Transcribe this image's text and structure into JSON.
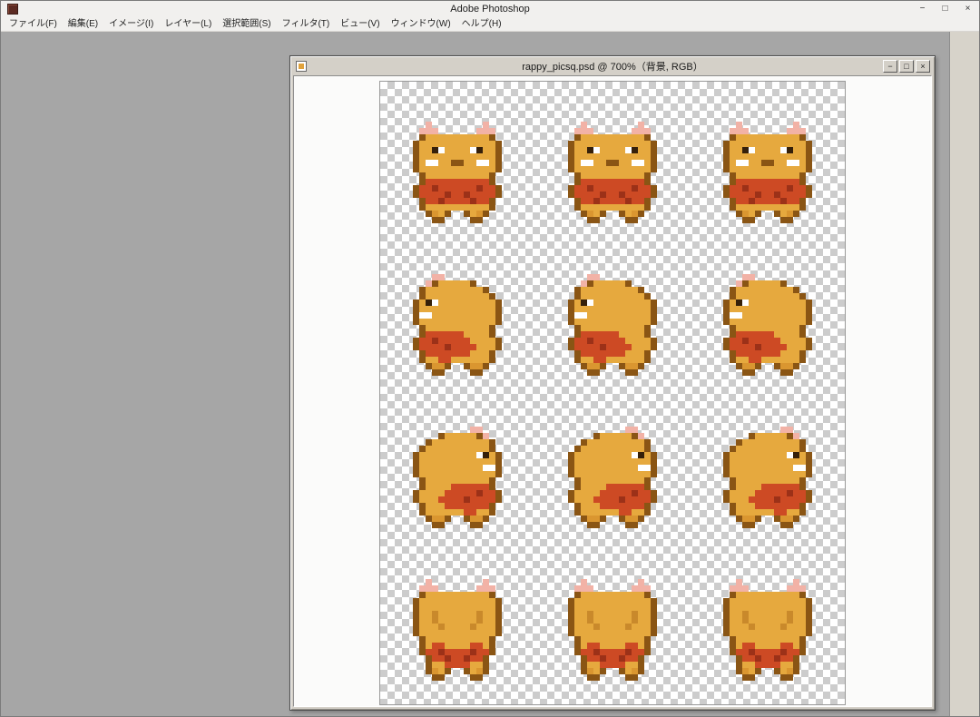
{
  "app": {
    "title": "Adobe Photoshop",
    "controls": {
      "minimize": "−",
      "maximize": "□",
      "close": "×"
    }
  },
  "menu": {
    "items": [
      "ファイル(F)",
      "編集(E)",
      "イメージ(I)",
      "レイヤー(L)",
      "選択範囲(S)",
      "フィルタ(T)",
      "ビュー(V)",
      "ウィンドウ(W)",
      "ヘルプ(H)"
    ]
  },
  "doc": {
    "title": "rappy_picsq.psd @ 700%（背景, RGB）",
    "file_name": "rappy_picsq.psd",
    "zoom": "700%",
    "layer": "背景",
    "mode": "RGB",
    "controls": {
      "minimize": "−",
      "maximize": "□",
      "close": "×"
    }
  },
  "canvas": {
    "checker_light": "#ffffff",
    "checker_dark": "#cccccc"
  },
  "sprite_sheet": {
    "rows": 4,
    "cols": 3,
    "row_directions": [
      "front",
      "left",
      "right",
      "back"
    ],
    "pixel_size": 7,
    "palette": {
      "K": "#8a5514",
      "Y": "#e6a93e",
      "d": "#c9892b",
      "P": "#f2b2a6",
      "W": "#ffffff",
      "B": "#35200a",
      "R": "#cd4a24",
      "r": "#9c3118",
      "o": "#da9630"
    },
    "maps": {
      "front": [
        "..P........P..",
        ".PPP......PPP.",
        ".KYYYYYYYYYYK.",
        "KYYYYYYYYYYYYK",
        "KYYBWYYYYWBYYK",
        "KYYYYYYYYYYYYK",
        "KYWWYYKKYYWWYK",
        "KYYYYYYYYYYYYK",
        ".KYYYYYYYYYYK.",
        ".KRRRRRRRRRRK.",
        "KRRrRRRRRRrRRK",
        "KRRRRrRRrRRRRK",
        ".KRRrRRRRrRRK.",
        ".KYYYYYYYYYYK.",
        "..KoYK..KYoK..",
        "...KK....KK..."
      ],
      "left": [
        "...PP.........",
        "..PKYYYYYK....",
        ".KYYYYYYYYYK..",
        ".KYYYYYYYYYYK.",
        "KYBWYYYYYYYYYK",
        "KYYYYYYYYYYYYK",
        "KWWYYYYYYYYYYK",
        "KYYYYYYYYYYYYK",
        ".KYYYYYYYYYYK.",
        ".KRRRRRRYYYYK.",
        "KRRrRRRRRYYYYK",
        "KRRRRrRRRRYYYK",
        ".KRRRRRRRYYYK.",
        ".KYYRRYYYYYYK.",
        "..KooK..KooK..",
        "...KK....KK..."
      ],
      "back": [
        "..P........P..",
        ".PPP......PPP.",
        ".KYYYYYYYYYYK.",
        "KYYYYYYYYYYYYK",
        "KYYYYYYYYYYYYK",
        "KYYdYYYYYYdYYK",
        "KYYdYYYYYYdYYK",
        "KYYYdYYYYdYYYK",
        "KYYYYYYYYYYYYK",
        ".KYYYYYYYYYYK.",
        ".KYRRYYYYRRYK.",
        ".KRRrRRRRrRRK.",
        "..KRRrRRrRRK..",
        "..KYYRRRRYYK..",
        "..KoYK..KYoK..",
        "...KK....KK..."
      ]
    }
  },
  "colors": {
    "workspace": "#a6a6a6",
    "chrome": "#f1f0ee",
    "doc_chrome": "#d4d0c8",
    "side_strip": "#d7d3ca"
  }
}
